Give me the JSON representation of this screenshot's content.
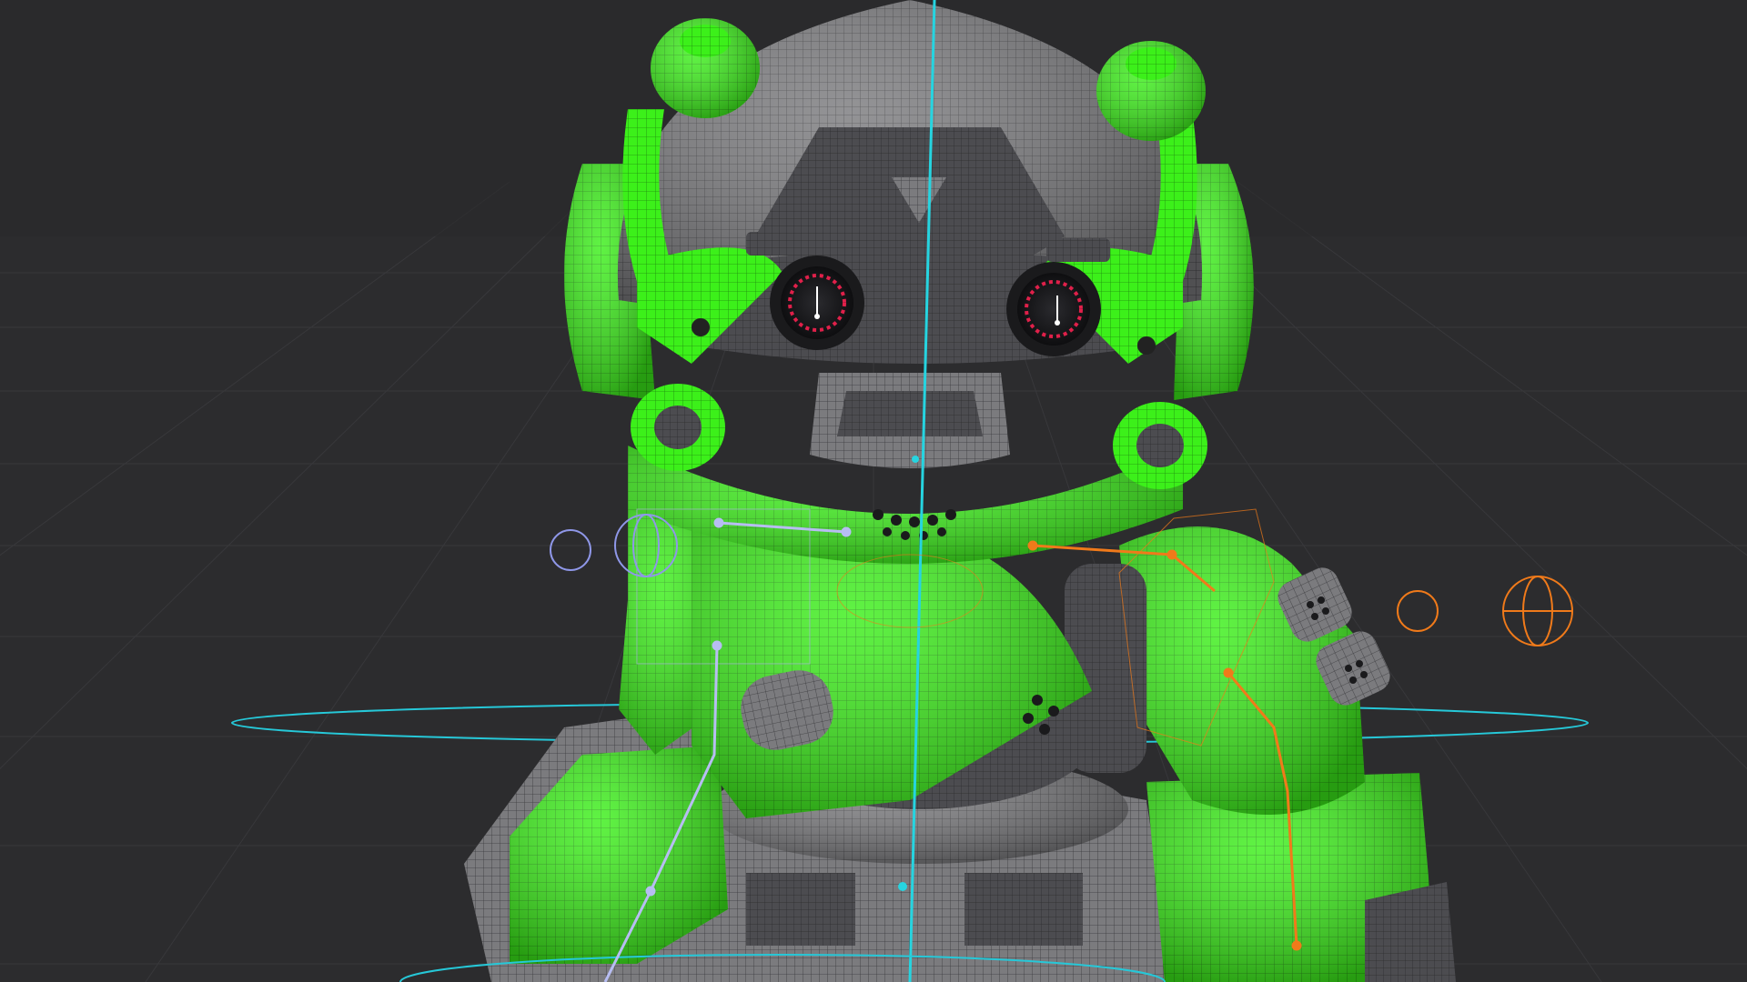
{
  "viewport": {
    "kind": "3d-viewport",
    "background": "#2b2b2d",
    "grid_color": "#3a3a3c",
    "horizon_shade": "#262628"
  },
  "model": {
    "subject": "robot",
    "primary_color": "#3cf01a",
    "primary_dark": "#2bb512",
    "secondary_color": "#7a7a7c",
    "secondary_dark": "#4a4a4c",
    "wire_color": "#1c1c1e",
    "eye_glow": "#e0204a"
  },
  "rig": {
    "center_axis_color": "#26d4e0",
    "left_bones_color": "#b7bdf2",
    "right_bones_color": "#f07a1a",
    "controls": [
      "root-control",
      "spine-bone",
      "left-arm-bones",
      "right-arm-bones",
      "left-ik-target",
      "right-ik-target"
    ]
  }
}
